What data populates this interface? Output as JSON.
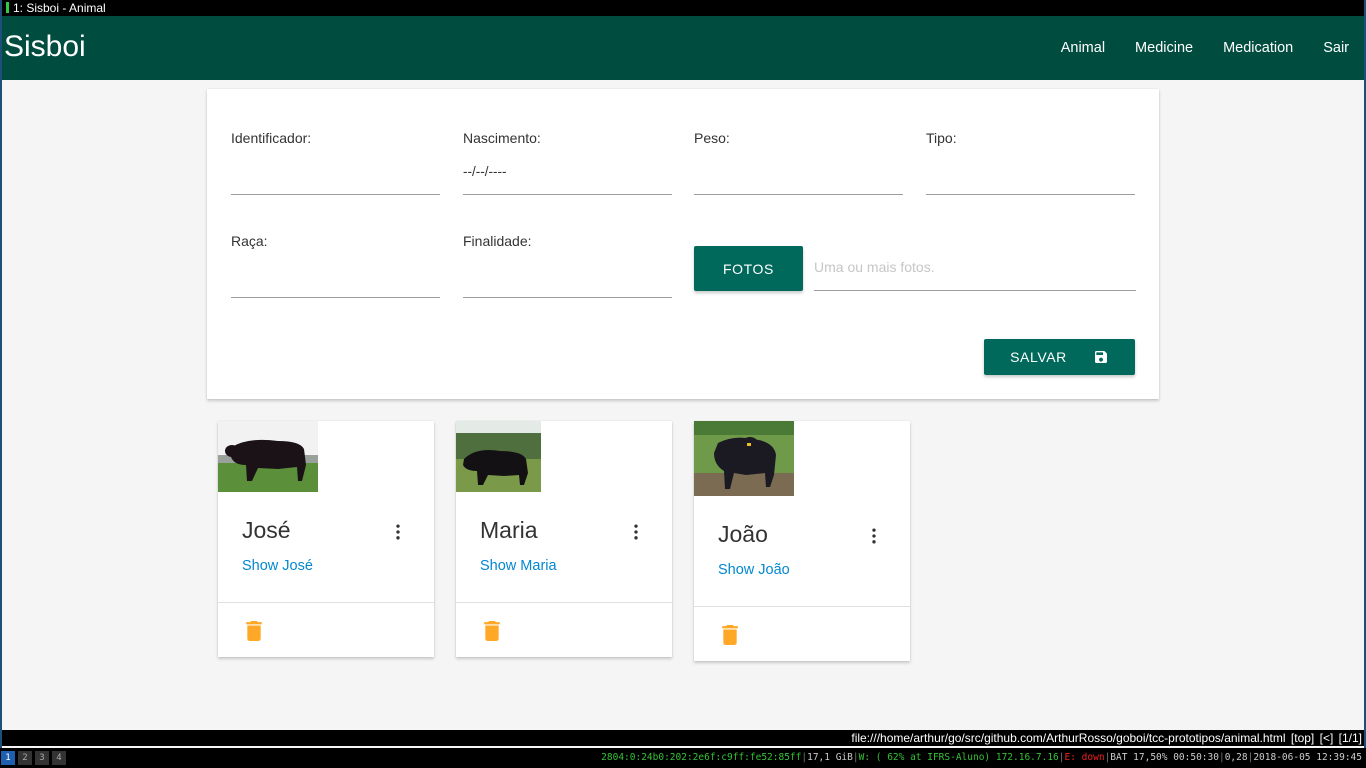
{
  "window": {
    "title": "1: Sisboi - Animal"
  },
  "nav": {
    "brand": "Sisboi",
    "links": [
      {
        "label": "Animal"
      },
      {
        "label": "Medicine"
      },
      {
        "label": "Medication"
      },
      {
        "label": "Sair"
      }
    ]
  },
  "form": {
    "identificador": {
      "label": "Identificador:",
      "value": ""
    },
    "nascimento": {
      "label": "Nascimento:",
      "value": "--/--/----"
    },
    "peso": {
      "label": "Peso:",
      "value": ""
    },
    "tipo": {
      "label": "Tipo:",
      "value": ""
    },
    "raca": {
      "label": "Raça:",
      "value": ""
    },
    "finalidade": {
      "label": "Finalidade:",
      "value": ""
    },
    "fotos_button": "FOTOS",
    "fotos_placeholder": "Uma ou mais fotos.",
    "save_button": "SALVAR",
    "save_icon": "save-icon"
  },
  "animals": [
    {
      "name": "José",
      "link": "Show José"
    },
    {
      "name": "Maria",
      "link": "Show Maria"
    },
    {
      "name": "João",
      "link": "Show João"
    }
  ],
  "icons": {
    "more": "more-vert-icon",
    "delete": "trash-icon"
  },
  "colors": {
    "primary": "#004d40",
    "button": "#00695c",
    "link": "#0288d1",
    "delete": "#ffa726"
  },
  "browser_status": {
    "url": "file:///home/arthur/go/src/github.com/ArthurRosso/goboi/tcc-prototipos/animal.html",
    "position": "[top]",
    "nav": "[<]",
    "page": "[1/1]"
  },
  "taskbar": {
    "workspaces": [
      "1",
      "2",
      "3",
      "4"
    ],
    "ipv6": "2804:0:24b0:202:2e6f:c9ff:fe52:85ff",
    "disk": "17,1 GiB",
    "wifi": "W: ( 62% at IFRS-Aluno) 172.16.7.16",
    "ethernet": "E: down",
    "battery": "BAT 17,50% 00:50:30",
    "load": "0,28",
    "datetime": "2018-06-05 12:39:45"
  }
}
